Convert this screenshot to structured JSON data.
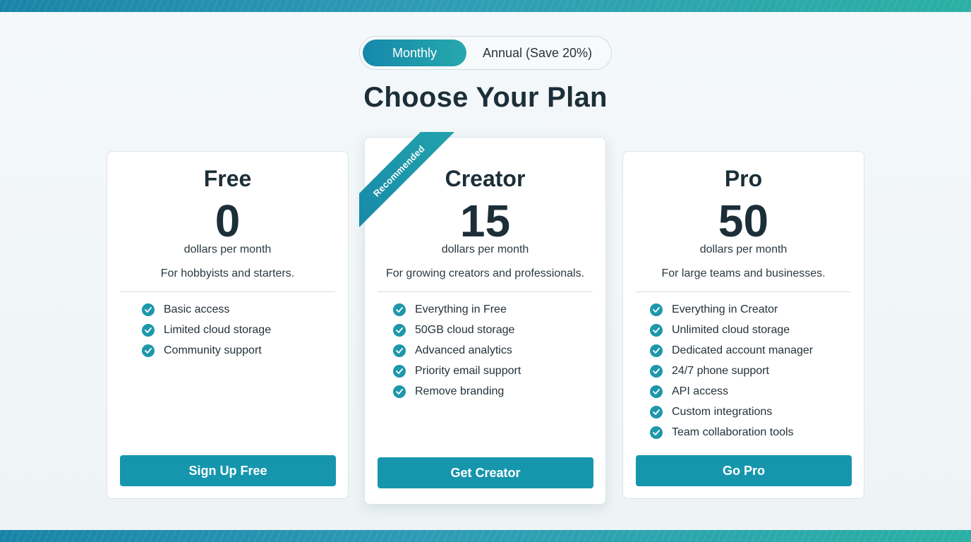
{
  "toggle": {
    "monthly_label": "Monthly",
    "annual_label": "Annual (Save 20%)",
    "selected": "Monthly"
  },
  "title": "Choose Your Plan",
  "plans": [
    {
      "name": "Free",
      "price": "0",
      "period": "dollars per month",
      "description": "For hobbyists and starters.",
      "features": [
        "Basic access",
        "Limited cloud storage",
        "Community support"
      ],
      "cta": "Sign Up Free"
    },
    {
      "name": "Creator",
      "price": "15",
      "period": "dollars per month",
      "description": "For growing creators and professionals.",
      "badge": "Recommended",
      "features": [
        "Everything in Free",
        "50GB cloud storage",
        "Advanced analytics",
        "Priority email support",
        "Remove branding"
      ],
      "cta": "Get Creator"
    },
    {
      "name": "Pro",
      "price": "50",
      "period": "dollars per month",
      "description": "For large teams and businesses.",
      "features": [
        "Everything in Creator",
        "Unlimited cloud storage",
        "Dedicated account manager",
        "24/7 phone support",
        "API access",
        "Custom integrations",
        "Team collaboration tools"
      ],
      "cta": "Go Pro"
    }
  ],
  "colors": {
    "accent": "#1696ad",
    "heading": "#1c2e38",
    "band_start": "#1a84a8",
    "band_end": "#2ab0a4"
  }
}
